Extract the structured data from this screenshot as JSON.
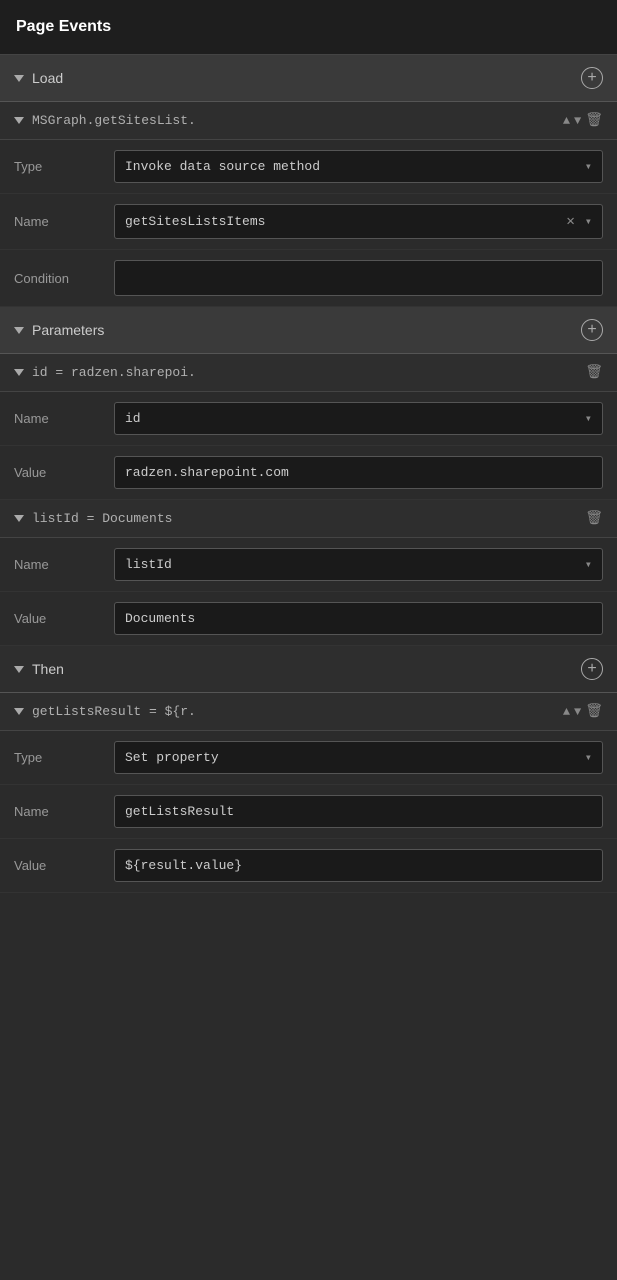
{
  "header": {
    "title": "Page Events"
  },
  "load_section": {
    "label": "Load"
  },
  "msgraph_section": {
    "label": "MSGraph.getSitesList.",
    "type_label": "Type",
    "type_value": "Invoke data source method",
    "name_label": "Name",
    "name_value": "getSitesListsItems",
    "condition_label": "Condition",
    "condition_value": ""
  },
  "parameters_section": {
    "label": "Parameters"
  },
  "id_param": {
    "label": "id = radzen.sharepoi.",
    "name_label": "Name",
    "name_value": "id",
    "value_label": "Value",
    "value_value": "radzen.sharepoint.com"
  },
  "listId_param": {
    "label": "listId = Documents",
    "name_label": "Name",
    "name_value": "listId",
    "value_label": "Value",
    "value_value": "Documents"
  },
  "then_section": {
    "label": "Then"
  },
  "getListsResult_section": {
    "label": "getListsResult = ${r.",
    "type_label": "Type",
    "type_value": "Set property",
    "name_label": "Name",
    "name_value": "getListsResult",
    "value_label": "Value",
    "value_value": "${result.value}"
  }
}
